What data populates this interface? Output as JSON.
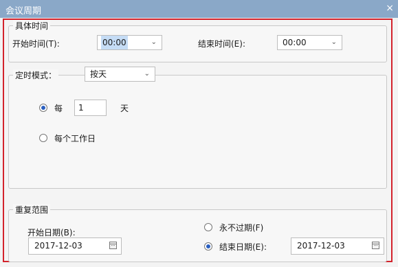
{
  "window": {
    "title": "会议周期",
    "close_glyph": "×"
  },
  "time_group": {
    "legend": "具体时间",
    "start_label": "开始时间(T):",
    "start_value": "00:00",
    "end_label": "结束时间(E):",
    "end_value": "00:00"
  },
  "mode_group": {
    "legend": "定时模式：",
    "mode_value": "按天",
    "option_every": {
      "prefix": "每",
      "value": "1",
      "suffix": "天",
      "checked": true
    },
    "option_workday": {
      "label": "每个工作日",
      "checked": false
    }
  },
  "repeat_group": {
    "legend": "重复范围",
    "start_date_label": "开始日期(B):",
    "start_date_value": "2017-12-03",
    "never_expire_label": "永不过期(F)",
    "never_expire_checked": false,
    "end_date_label": "结束日期(E):",
    "end_date_value": "2017-12-03",
    "end_date_checked": true
  },
  "icons": {
    "dropdown": "chevron-down-icon",
    "calendar": "calendar-icon"
  },
  "colors": {
    "title_bar": "#8aa8c8",
    "highlight_border": "#d3222b",
    "selection": "#c5dcf5",
    "radio_dot": "#2a5fbf"
  }
}
